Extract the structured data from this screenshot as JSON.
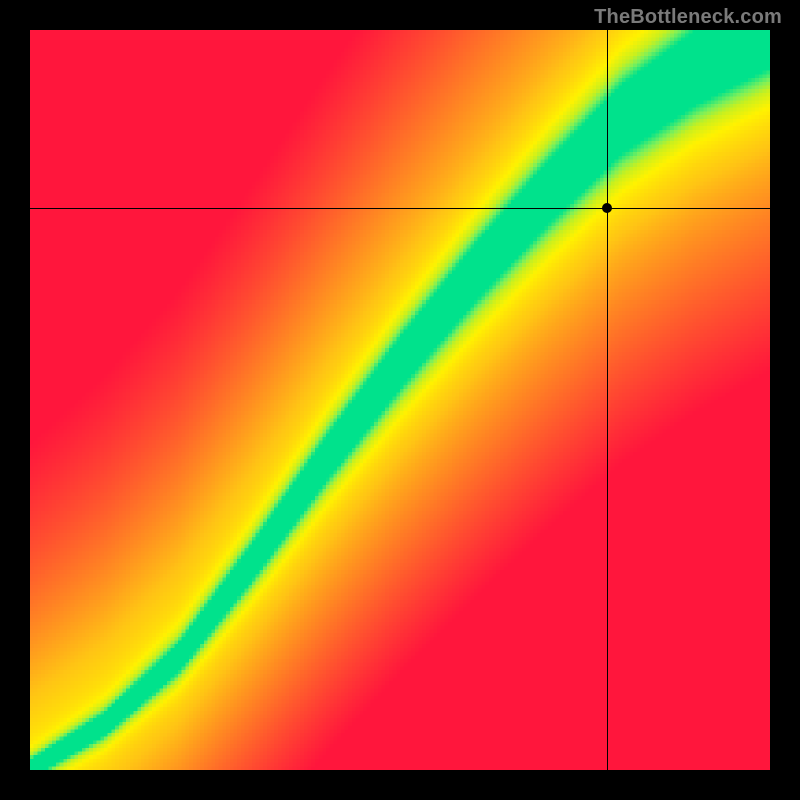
{
  "watermark": {
    "text": "TheBottleneck.com"
  },
  "chart_data": {
    "type": "heatmap",
    "title": "",
    "xlabel": "",
    "ylabel": "",
    "xlim": [
      0,
      100
    ],
    "ylim": [
      0,
      100
    ],
    "legend": false,
    "grid": false,
    "resolution": 200,
    "colorscale": [
      {
        "stop": 0.0,
        "color": "#ff163c"
      },
      {
        "stop": 0.25,
        "color": "#ff6e28"
      },
      {
        "stop": 0.5,
        "color": "#ffc414"
      },
      {
        "stop": 0.7,
        "color": "#fff200"
      },
      {
        "stop": 0.82,
        "color": "#c9f01e"
      },
      {
        "stop": 0.9,
        "color": "#7df05a"
      },
      {
        "stop": 1.0,
        "color": "#00e28c"
      }
    ],
    "ridge": {
      "description": "optimal-balance curve; green band runs along this path",
      "points": [
        {
          "x": 0,
          "y": 0
        },
        {
          "x": 10,
          "y": 6
        },
        {
          "x": 20,
          "y": 15
        },
        {
          "x": 30,
          "y": 28
        },
        {
          "x": 40,
          "y": 42
        },
        {
          "x": 50,
          "y": 55
        },
        {
          "x": 60,
          "y": 67
        },
        {
          "x": 70,
          "y": 78
        },
        {
          "x": 80,
          "y": 88
        },
        {
          "x": 90,
          "y": 95
        },
        {
          "x": 100,
          "y": 100
        }
      ],
      "half_width_start": 2,
      "half_width_end": 10
    },
    "marker": {
      "x": 78,
      "y": 76,
      "crosshair": true
    }
  }
}
